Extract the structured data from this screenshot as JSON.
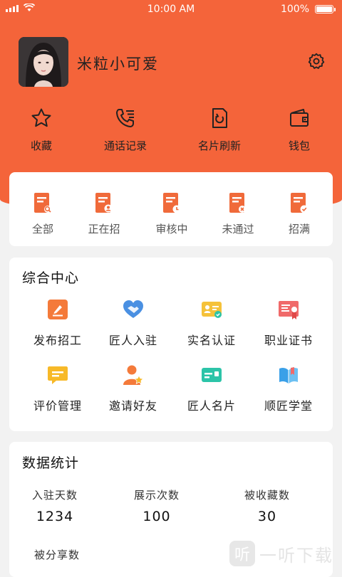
{
  "status_bar": {
    "time": "10:00 AM",
    "battery": "100%"
  },
  "profile": {
    "name": "米粒小可爱"
  },
  "quick_actions": [
    {
      "label": "收藏",
      "icon": "star-icon"
    },
    {
      "label": "通话记录",
      "icon": "call-log-icon"
    },
    {
      "label": "名片刷新",
      "icon": "refresh-card-icon"
    },
    {
      "label": "钱包",
      "icon": "wallet-icon"
    }
  ],
  "job_status": [
    {
      "label": "全部",
      "icon": "doc-search-icon"
    },
    {
      "label": "正在招",
      "icon": "doc-recruiting-icon"
    },
    {
      "label": "审核中",
      "icon": "doc-clock-icon"
    },
    {
      "label": "未通过",
      "icon": "doc-rejected-icon"
    },
    {
      "label": "招满",
      "icon": "doc-check-icon"
    }
  ],
  "center": {
    "title": "综合中心",
    "items": [
      {
        "label": "发布招工",
        "icon": "post-job-icon",
        "color": "#f47a3a"
      },
      {
        "label": "匠人入驻",
        "icon": "handshake-icon",
        "color": "#4a90e2"
      },
      {
        "label": "实名认证",
        "icon": "id-card-icon",
        "color": "#f5c23a"
      },
      {
        "label": "职业证书",
        "icon": "certificate-icon",
        "color": "#f06a6a"
      },
      {
        "label": "评价管理",
        "icon": "comment-icon",
        "color": "#f7b928"
      },
      {
        "label": "邀请好友",
        "icon": "invite-friend-icon",
        "color": "#f47a3a"
      },
      {
        "label": "匠人名片",
        "icon": "business-card-icon",
        "color": "#2cc4a8"
      },
      {
        "label": "顺匠学堂",
        "icon": "book-icon",
        "color": "#3aa0e8"
      }
    ]
  },
  "stats": {
    "title": "数据统计",
    "items": [
      {
        "label": "入驻天数",
        "value": "1234"
      },
      {
        "label": "展示次数",
        "value": "100"
      },
      {
        "label": "被收藏数",
        "value": "30"
      },
      {
        "label": "被分享数",
        "value": ""
      }
    ]
  },
  "watermark": {
    "text": "一听下载",
    "glyph": "听"
  },
  "colors": {
    "brand": "#f4643a",
    "icon_orange": "#f06a3a"
  }
}
